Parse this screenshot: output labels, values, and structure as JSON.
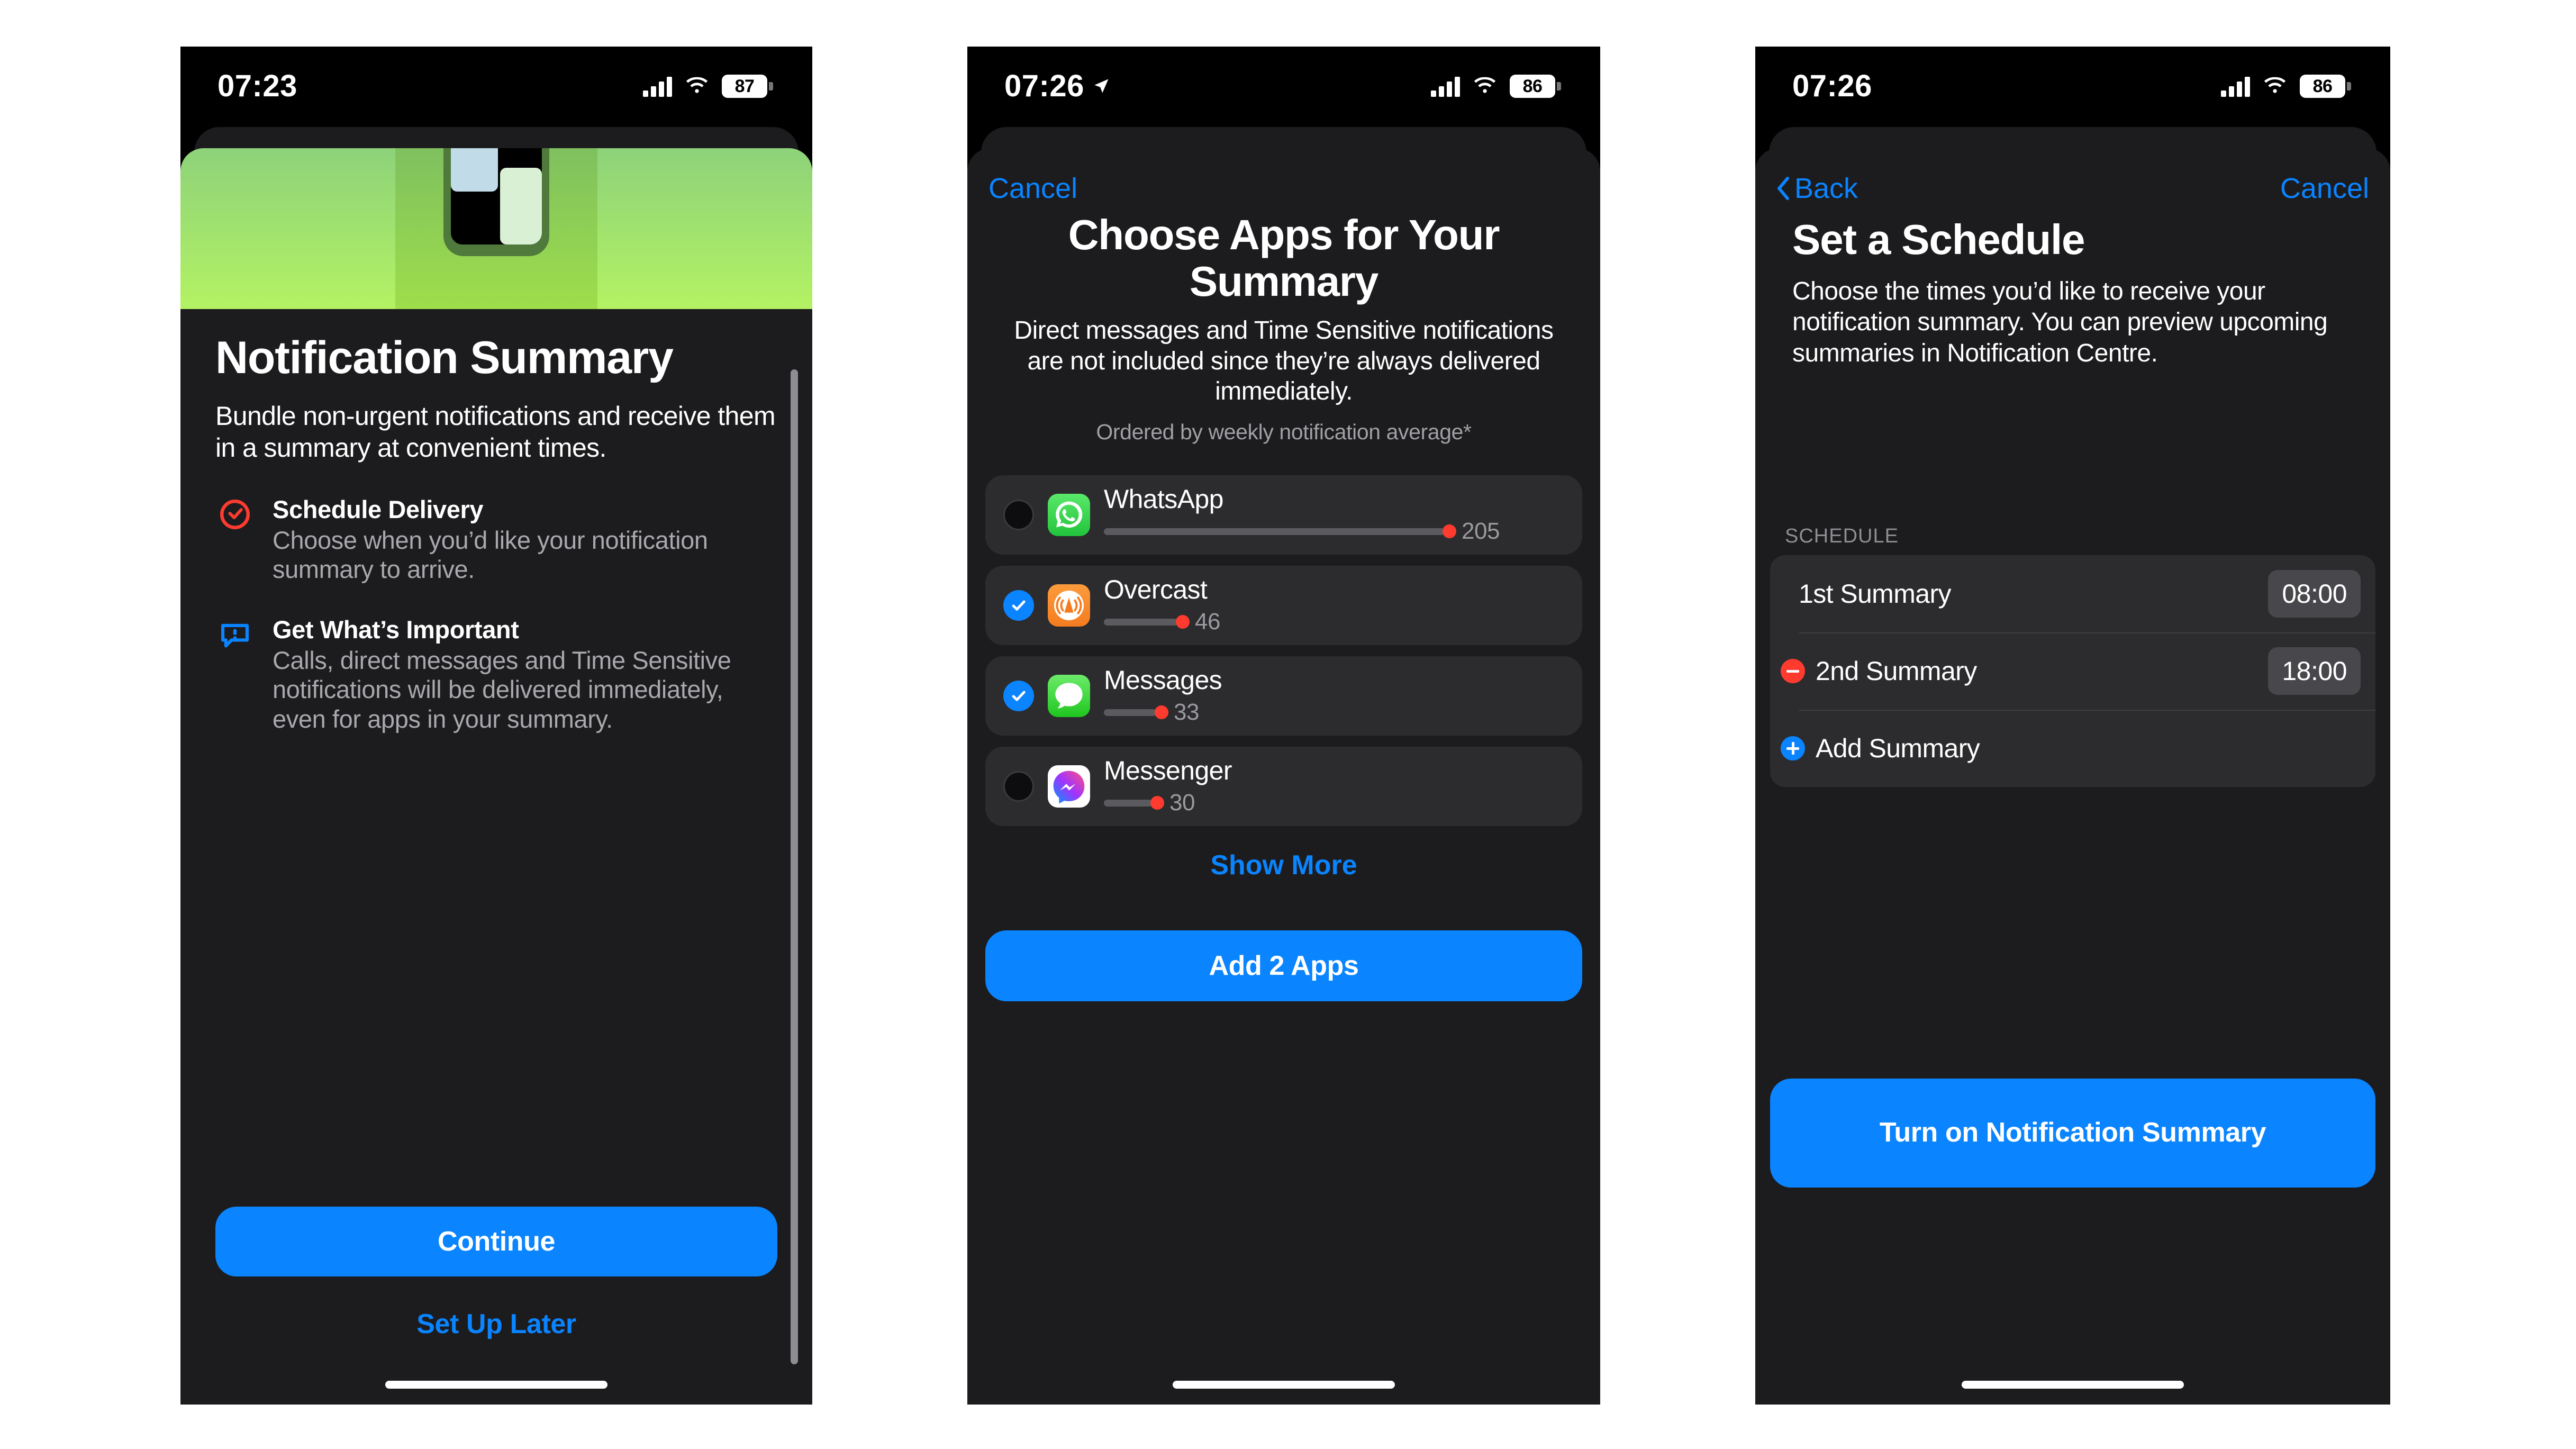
{
  "phones": [
    {
      "id": "phone-intro",
      "status_bar": {
        "time": "07:23",
        "battery": "87",
        "location_arrow": false
      },
      "hero": {
        "alt": "notification summary illustration"
      },
      "title": "Notification Summary",
      "intro": "Bundle non-urgent notifications and receive them in a summary at convenient times.",
      "features": [
        {
          "icon": "clock-check-icon",
          "heading": "Schedule Delivery",
          "body": "Choose when you’d like your notification summary to arrive."
        },
        {
          "icon": "speech-bubble-exclamation-icon",
          "heading": "Get What’s Important",
          "body": "Calls, direct messages and Time Sensitive notifications will be delivered immediately, even for apps in your summary."
        }
      ],
      "primary_button": "Continue",
      "secondary_button": "Set Up Later"
    },
    {
      "id": "phone-choose-apps",
      "status_bar": {
        "time": "07:26",
        "battery": "86",
        "location_arrow": true
      },
      "nav": {
        "left": "",
        "right": "",
        "cancel": "Cancel"
      },
      "title": "Choose Apps for Your Summary",
      "subtitle": "Direct messages and Time Sensitive notifications are not included since they’re always delivered immediately.",
      "ordering_note": "Ordered by weekly notification average*",
      "apps": [
        {
          "name": "WhatsApp",
          "count": "205",
          "selected": false,
          "bar_pct": 100,
          "icon": "whatsapp-icon"
        },
        {
          "name": "Overcast",
          "count": "46",
          "selected": true,
          "bar_pct": 22,
          "icon": "overcast-icon"
        },
        {
          "name": "Messages",
          "count": "33",
          "selected": true,
          "bar_pct": 16,
          "icon": "messages-icon"
        },
        {
          "name": "Messenger",
          "count": "30",
          "selected": false,
          "bar_pct": 15,
          "icon": "messenger-icon"
        }
      ],
      "show_more": "Show More",
      "primary_button": "Add 2 Apps"
    },
    {
      "id": "phone-set-schedule",
      "status_bar": {
        "time": "07:26",
        "battery": "86",
        "location_arrow": false
      },
      "nav": {
        "back": "Back",
        "cancel": "Cancel"
      },
      "title": "Set a Schedule",
      "subtitle": "Choose the times you’d like to receive your notification summary. You can preview upcoming summaries in Notification Centre.",
      "section_label": "SCHEDULE",
      "schedule": [
        {
          "badge": "none",
          "label": "1st Summary",
          "time": "08:00"
        },
        {
          "badge": "minus",
          "label": "2nd Summary",
          "time": "18:00"
        },
        {
          "badge": "plus",
          "label": "Add Summary",
          "time": ""
        }
      ],
      "primary_button": "Turn on Notification Summary"
    }
  ],
  "colors": {
    "accent_blue": "#0a84ff",
    "destructive_red": "#ff3b30",
    "sheet_bg": "#1c1c1e",
    "row_bg": "#2c2c2e",
    "muted_text": "#8e8e93"
  }
}
